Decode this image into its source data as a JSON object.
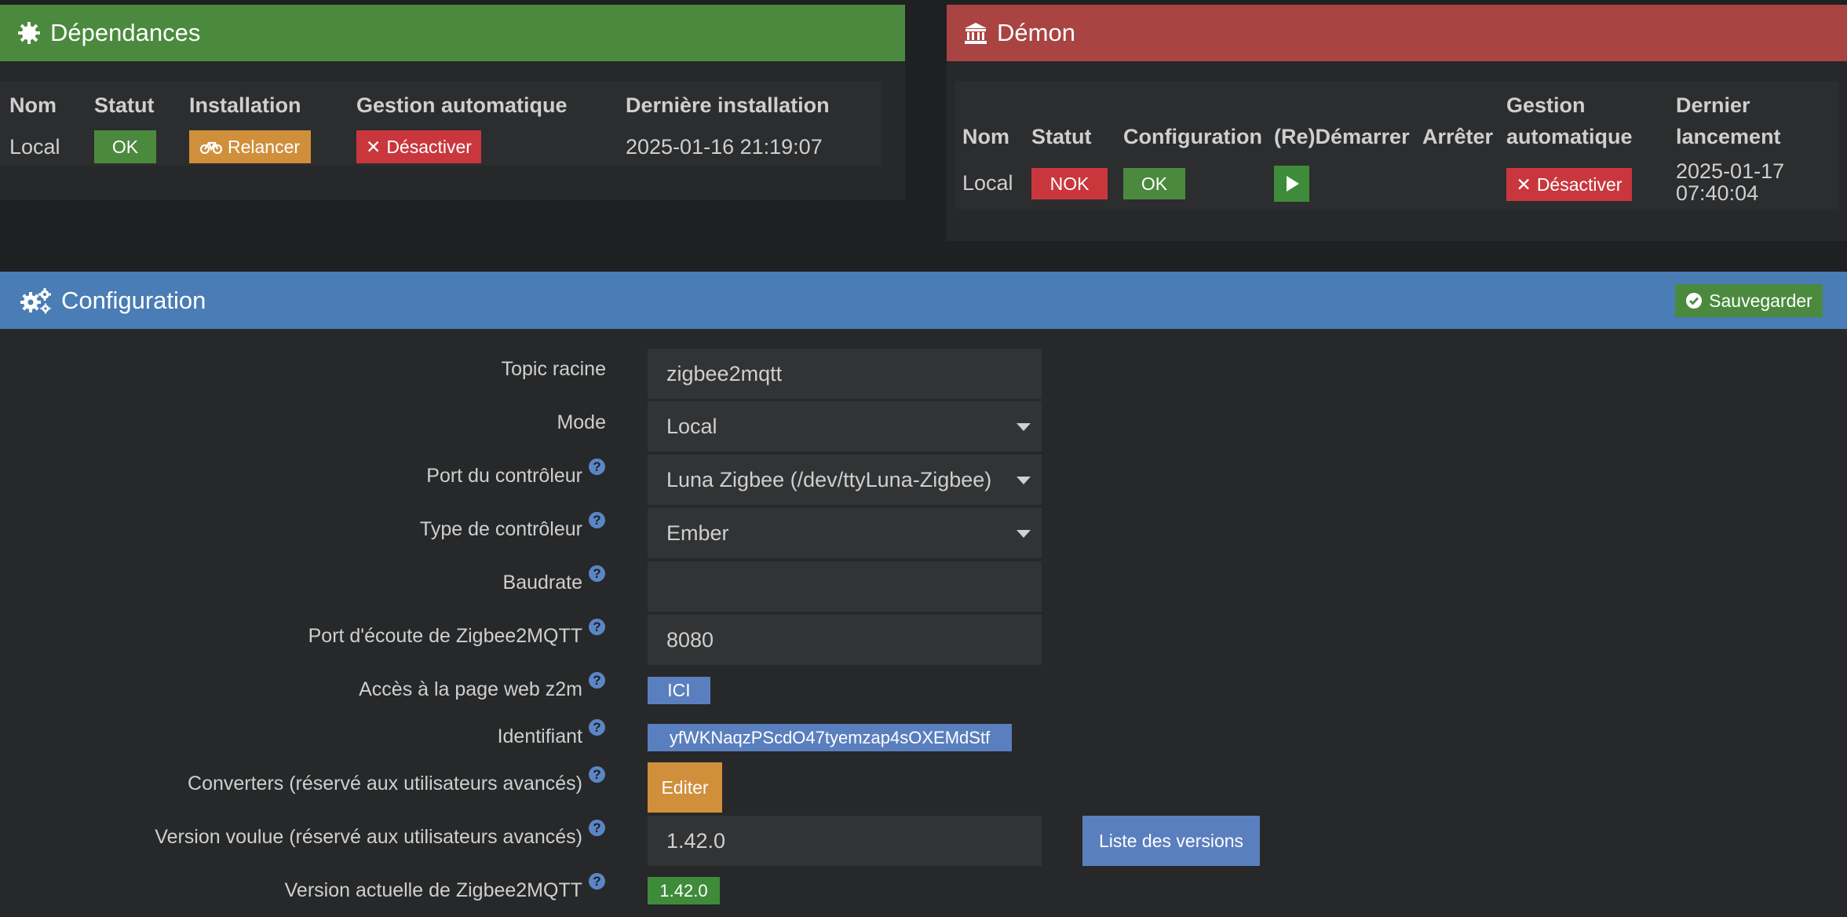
{
  "dependencies": {
    "title": "Dépendances",
    "headers": [
      "Nom",
      "Statut",
      "Installation",
      "Gestion automatique",
      "Dernière installation"
    ],
    "row": {
      "name": "Local",
      "status": "OK",
      "install_button": "Relancer",
      "auto_button": "Désactiver",
      "last_install": "2025-01-16 21:19:07"
    }
  },
  "daemon": {
    "title": "Démon",
    "headers": {
      "name": "Nom",
      "status": "Statut",
      "config": "Configuration",
      "restart": "(Re)Démarrer",
      "stop": "Arrêter",
      "auto_line1": "Gestion",
      "auto_line2": "automatique",
      "last_line1": "Dernier",
      "last_line2": "lancement"
    },
    "row": {
      "name": "Local",
      "status": "NOK",
      "config": "OK",
      "auto_button": "Désactiver",
      "last_date": "2025-01-17",
      "last_time": "07:40:04"
    }
  },
  "configuration": {
    "title": "Configuration",
    "save_button": "Sauvegarder",
    "fields": {
      "topic_label": "Topic racine",
      "topic_value": "zigbee2mqtt",
      "mode_label": "Mode",
      "mode_value": "Local",
      "port_label": "Port du contrôleur",
      "port_value": "Luna Zigbee (/dev/ttyLuna-Zigbee)",
      "type_label": "Type de contrôleur",
      "type_value": "Ember",
      "baud_label": "Baudrate",
      "baud_value": "",
      "listen_label": "Port d'écoute de Zigbee2MQTT",
      "listen_value": "8080",
      "web_label": "Accès à la page web z2m",
      "web_button": "ICI",
      "id_label": "Identifiant",
      "id_value": "yfWKNaqzPScdO47tyemzap4sOXEMdStf",
      "conv_label": "Converters (réservé aux utilisateurs avancés)",
      "conv_button": "Editer",
      "version_label": "Version voulue (réservé aux utilisateurs avancés)",
      "version_value": "1.42.0",
      "versions_button": "Liste des versions",
      "current_label": "Version actuelle de Zigbee2MQTT",
      "current_value": "1.42.0"
    },
    "help_glyph": "?"
  },
  "colors": {
    "green": "#4b8a3e",
    "red": "#a94442",
    "blue": "#4a7cb5",
    "orange": "#d08f3b",
    "button_red": "#c9373d"
  },
  "icons": {
    "dependencies": "gear-icon",
    "daemon": "bank-icon",
    "configuration": "cogs-icon",
    "relaunch": "bicycle-icon",
    "deactivate": "times-icon",
    "start": "play-icon",
    "save": "check-circle-icon",
    "help": "question-circle-icon",
    "select": "caret-down-icon"
  }
}
